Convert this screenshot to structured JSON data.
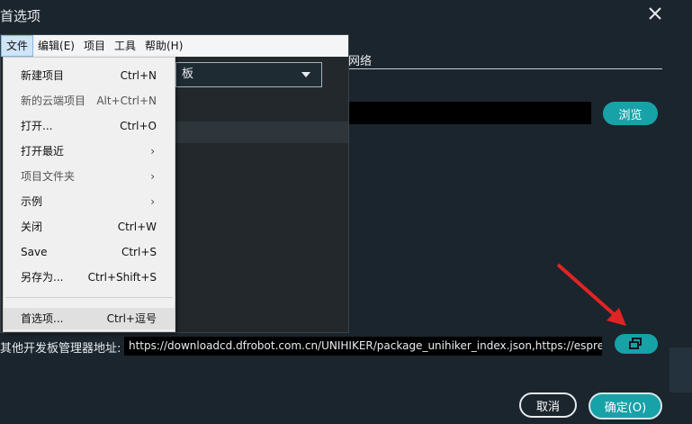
{
  "dialog": {
    "title": "首选项"
  },
  "tabs": {
    "network_partial": "网络"
  },
  "settings": {
    "browse_label": "浏览"
  },
  "boards_manager": {
    "label": "其他开发板管理器地址:",
    "value": "https://downloadcd.dfrobot.com.cn/UNIHIKER/package_unihiker_index.json,https://espres"
  },
  "buttons": {
    "cancel": "取消",
    "ok": "确定(O)"
  },
  "ide": {
    "menubar": [
      "文件",
      "编辑(E)",
      "项目",
      "工具",
      "帮助(H)"
    ],
    "board_select_partial": "板"
  },
  "file_menu": {
    "items": [
      {
        "label": "新建项目",
        "shortcut": "Ctrl+N"
      },
      {
        "label": "新的云端项目",
        "shortcut": "Alt+Ctrl+N"
      },
      {
        "label": "打开...",
        "shortcut": "Ctrl+O"
      },
      {
        "label": "打开最近",
        "submenu": "›"
      },
      {
        "label": "项目文件夹",
        "submenu": "›"
      },
      {
        "label": "示例",
        "submenu": "›"
      },
      {
        "label": "关闭",
        "shortcut": "Ctrl+W"
      },
      {
        "label": "Save",
        "shortcut": "Ctrl+S"
      },
      {
        "label": "另存为...",
        "shortcut": "Ctrl+Shift+S"
      },
      {
        "label": "首选项...",
        "shortcut": "Ctrl+逗号"
      }
    ]
  },
  "colors": {
    "accent": "#17a2a8",
    "arrow": "#e02424"
  }
}
